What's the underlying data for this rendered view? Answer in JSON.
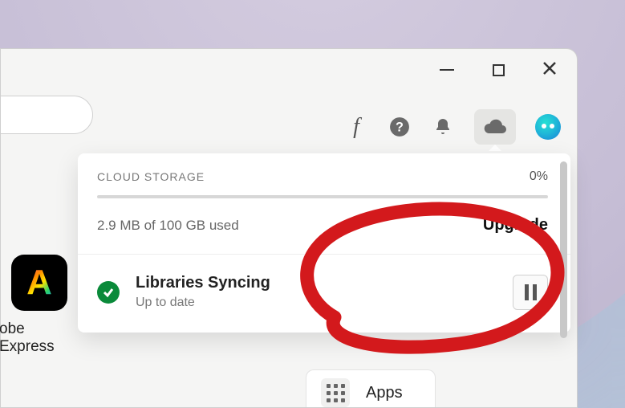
{
  "windowControls": {
    "minimize": "minimize",
    "maximize": "maximize",
    "close": "close"
  },
  "toolbar": {
    "fonts_glyph": "f",
    "help": "help",
    "notifications": "notifications",
    "cloud": "cloud",
    "profile": "profile"
  },
  "cloudPanel": {
    "storage_label": "CLOUD STORAGE",
    "storage_percent": "0%",
    "storage_used": "2.9 MB of 100 GB used",
    "upgrade_label": "Upgrade",
    "sync_title": "Libraries Syncing",
    "sync_status": "Up to date",
    "pause_label": "Pause"
  },
  "leftApp": {
    "letter": "A",
    "name": "obe Express"
  },
  "appsSwitcher": {
    "label": "Apps"
  },
  "annotation": {
    "shape": "red-oval-hand-drawn",
    "color": "#d3191c"
  }
}
